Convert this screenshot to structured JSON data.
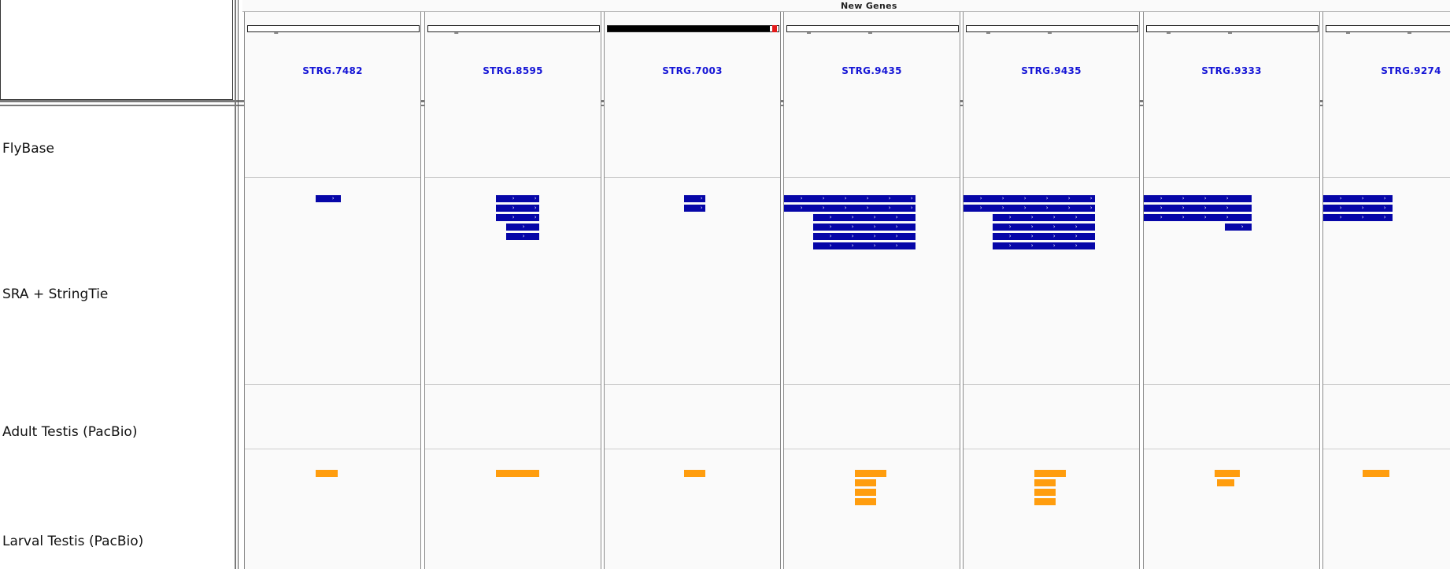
{
  "header": {
    "title": "New Genes"
  },
  "tracks": [
    {
      "label": "FlyBase"
    },
    {
      "label": "SRA + StringTie"
    },
    {
      "label": "Adult Testis (PacBio)"
    },
    {
      "label": "Larval Testis (PacBio)"
    }
  ],
  "panels": [
    {
      "chrom": "chrUn_DS483781v1",
      "gene": "STRG.7482",
      "ideogram_fill": 0.0,
      "ideogram_mark": null
    },
    {
      "chrom": "chrUn_DS483798v1",
      "gene": "STRG.8595",
      "ideogram_fill": 0.0,
      "ideogram_mark": null
    },
    {
      "chrom": "chrX",
      "gene": "STRG.7003",
      "ideogram_fill": 0.95,
      "ideogram_mark": 0.97
    },
    {
      "chrom": "chrY_DS483790v1_random",
      "gene": "STRG.9435",
      "ideogram_fill": 0.0,
      "ideogram_mark": null
    },
    {
      "chrom": "chrY_DS483790v1_random",
      "gene": "STRG.9435",
      "ideogram_fill": 0.0,
      "ideogram_mark": null
    },
    {
      "chrom": "chrY_DS484056v1_random",
      "gene": "STRG.9333",
      "ideogram_fill": 0.0,
      "ideogram_mark": null
    },
    {
      "chrom": "chrY_DS485013v1_random",
      "gene": "STRG.9274",
      "ideogram_fill": 0.0,
      "ideogram_mark": null
    }
  ],
  "colors": {
    "stringtie_feature": "#0606a8",
    "pacbio_feature": "#ff9d0e",
    "gene_label": "#1515d6",
    "ideogram_mark": "#e21b1b"
  }
}
